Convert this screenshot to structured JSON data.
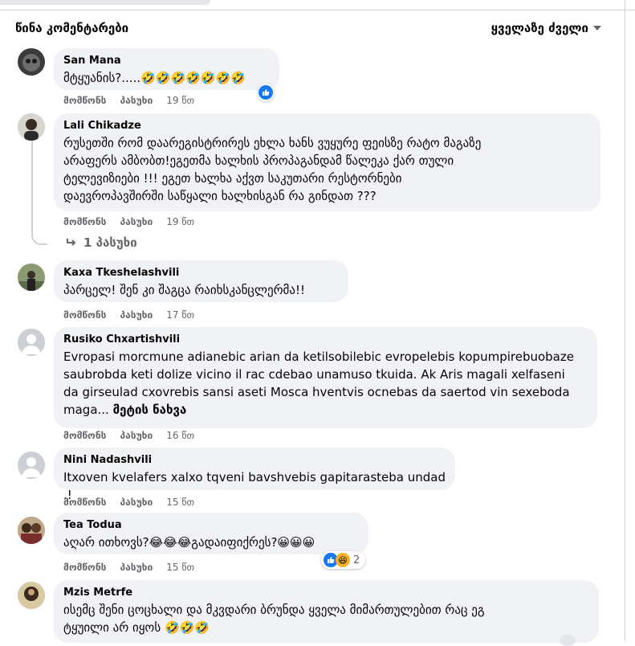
{
  "header": {
    "title": "წინა კომენტარები",
    "sort_label": "ყველაზე ძველი"
  },
  "actions": {
    "like": "მომწონს",
    "reply": "პასუხი"
  },
  "comments": [
    {
      "author": "San Mana",
      "text": "მტყუანის?.....",
      "emoji": "🤣🤣🤣🤣🤣🤣🤣",
      "time": "19 წთ"
    },
    {
      "author": "Lali Chikadze",
      "text": "რუსეთში რომ დაარეგისტრირეს ეხლა ხანს ვუყურე ფეისზე რატო მაგაზე\nარაფერს ამბობთ!ეგეთმა ხალხის პროპაგანდამ წალეკა ქარ თული\nტელევიზიები !!! ეგეთ ხალხა აქვთ საკუთარი რესტორნები\nდაევროპავშირში საწყალი ხალხისგან რა გინდათ ???",
      "time": "19 წთ"
    },
    {
      "author": "Kaxa Tkeshelashvili",
      "text": "პარცელ! შენ კი შაგცა რაიხსკანცლერმა!!",
      "time": "17 წთ"
    },
    {
      "author": "Rusiko Chxartishvili",
      "text": "Evropasi morcmune adianebic arian da ketilsobilebic evropelebis kopumpirebuobaze\nsaubrobda keti dolize vicino il rac cdebao unamuso tkuida. Ak Aris magali xelfaseni\nda girseulad cxovrebis sansi aseti Mosca hventvis ocnebas da saertod vin sexeboda\nmaga...",
      "see_more": "მეტის ნახვა",
      "time": "16 წთ"
    },
    {
      "author": "Nini Nadashvili",
      "text": "Itxoven kvelafers xalxo tqveni bavshvebis gapitarasteba undad .!",
      "time": "15 წთ"
    },
    {
      "author": "Tea Todua",
      "text": "აღარ ითხოვს?",
      "emoji_a": "😂😂😂",
      "text_b": "გადაიფიქრეს?",
      "emoji_b": "😀😀😀",
      "time": "15 წთ",
      "reaction_count": "2"
    },
    {
      "author": "Mzis Metrfe",
      "text": "ისემც შენი ცოცხალი და მკვდარი ბრუნდა ყველა მიმართულებით რაც ეგ\nტყუილი არ იყოს",
      "emoji": "🤣🤣🤣",
      "time": "15 წთ"
    }
  ],
  "replies_link": "1 პასუხი",
  "icons": {
    "like": "like-reaction-icon",
    "haha": "haha-reaction-icon",
    "reply_arrow": "reply-arrow-icon",
    "caret": "caret-down-icon"
  },
  "colors": {
    "bubble": "#f0f2f5",
    "meta_text": "#65676b",
    "like_blue": "#1877f2"
  }
}
